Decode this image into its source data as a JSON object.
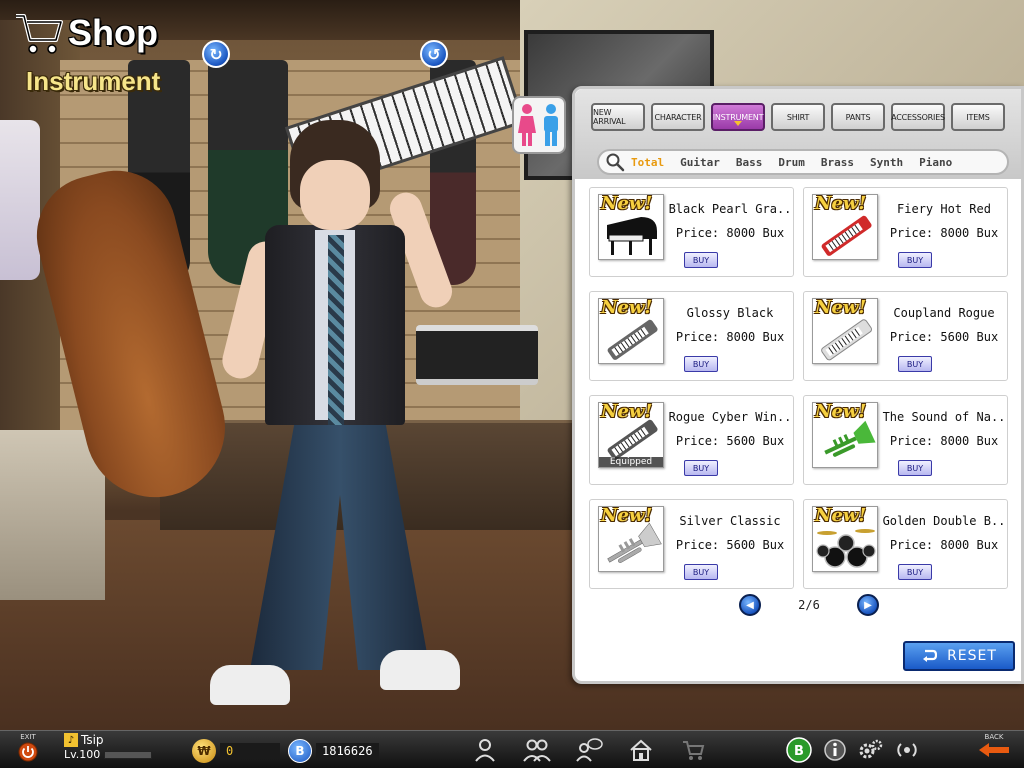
{
  "header": {
    "title": "Shop",
    "section": "Instrument"
  },
  "category_tabs": [
    {
      "label": "New arrival",
      "active": false
    },
    {
      "label": "Character",
      "active": false
    },
    {
      "label": "Instrument",
      "active": true
    },
    {
      "label": "Shirt",
      "active": false
    },
    {
      "label": "Pants",
      "active": false
    },
    {
      "label": "Accessories",
      "active": false
    },
    {
      "label": "Items",
      "active": false
    }
  ],
  "sub_tabs": [
    {
      "label": "Total",
      "active": true
    },
    {
      "label": "Guitar",
      "active": false
    },
    {
      "label": "Bass",
      "active": false
    },
    {
      "label": "Drum",
      "active": false
    },
    {
      "label": "Brass",
      "active": false
    },
    {
      "label": "Synth",
      "active": false
    },
    {
      "label": "Piano",
      "active": false
    }
  ],
  "items": [
    {
      "name": "Black Pearl Gra..",
      "price": "Price: 8000 Bux",
      "buy_label": "Buy",
      "badge": "New!",
      "icon": "grand-piano-icon"
    },
    {
      "name": "Fiery Hot Red",
      "price": "Price: 8000 Bux",
      "buy_label": "Buy",
      "badge": "New!",
      "icon": "keytar-red-icon"
    },
    {
      "name": "Glossy Black",
      "price": "Price: 8000 Bux",
      "buy_label": "Buy",
      "badge": "New!",
      "icon": "keytar-black-icon"
    },
    {
      "name": "Coupland Rogue",
      "price": "Price: 5600 Bux",
      "buy_label": "Buy",
      "badge": "New!",
      "icon": "keytar-white-icon"
    },
    {
      "name": "Rogue Cyber Win..",
      "price": "Price: 5600 Bux",
      "buy_label": "Buy",
      "badge": "New!",
      "icon": "keytar-equipped-icon",
      "equipped": "Equipped"
    },
    {
      "name": "The Sound of Na..",
      "price": "Price: 8000 Bux",
      "buy_label": "Buy",
      "badge": "New!",
      "icon": "trumpet-green-icon"
    },
    {
      "name": "Silver Classic",
      "price": "Price: 5600 Bux",
      "buy_label": "Buy",
      "badge": "New!",
      "icon": "trumpet-silver-icon"
    },
    {
      "name": "Golden Double B..",
      "price": "Price: 8000 Bux",
      "buy_label": "Buy",
      "badge": "New!",
      "icon": "drum-kit-icon"
    }
  ],
  "pager": {
    "page_text": "2/6"
  },
  "reset_label": "Reset",
  "bottom": {
    "exit_label": "Exit",
    "user_name": "Tsip",
    "level": "Lv.100",
    "coins_w": "0",
    "coins_b": "1816626",
    "back_label": "Back"
  },
  "colors": {
    "accent_purple": "#9a3aa8",
    "button_blue": "#1a5ac8",
    "gold_text": "#f6e58a",
    "active_subtab": "#e89a10"
  }
}
